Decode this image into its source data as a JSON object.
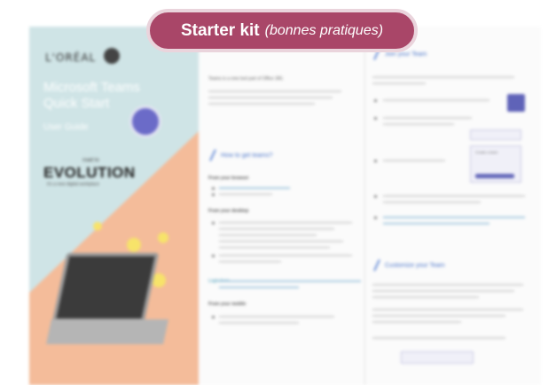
{
  "banner": {
    "title": "Starter kit",
    "subtitle": "(bonnes pratiques)"
  },
  "cover": {
    "brand": "L'ORÉAL",
    "title": "Microsoft Teams Quick Start",
    "subtitle": "User Guide",
    "evolution_small": "road to",
    "evolution": "EVOLUTION",
    "evolution_sub": "it's a new digital workplace"
  },
  "middle": {
    "intro_line1": "Teams is a new tool part of Office 365.",
    "heading_get": "How to get teams?",
    "sub_browser": "From your browser",
    "sub_desktop": "From your desktop",
    "link_text": "Login here",
    "sub_mobile": "From your mobile"
  },
  "right": {
    "heading_join": "Join your Team",
    "heading_customize": "Customize your Team",
    "thumb_label": "Create a team"
  },
  "colors": {
    "banner": "#a94668",
    "banner_border": "#ead4dc",
    "teal": "#cfe4e6",
    "peach": "#f4bc9a",
    "accent": "#4a75c9"
  }
}
